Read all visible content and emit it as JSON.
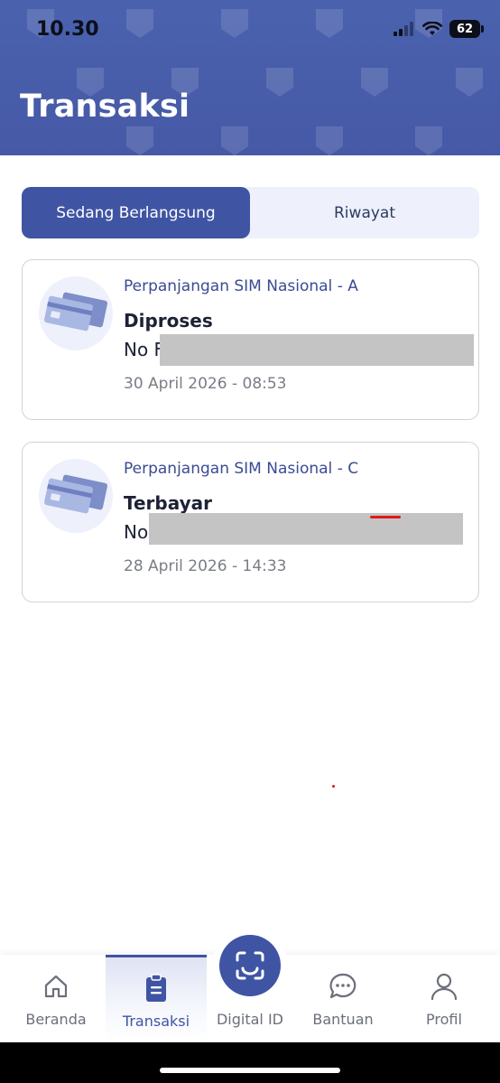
{
  "status_bar": {
    "time": "10.30",
    "battery": "62",
    "signal_icon": "cellular-signal-icon",
    "wifi_icon": "wifi-icon"
  },
  "header": {
    "title": "Transaksi"
  },
  "tabs": [
    {
      "label": "Sedang Berlangsung",
      "active": true
    },
    {
      "label": "Riwayat",
      "active": false
    }
  ],
  "transactions": [
    {
      "service": "Perpanjangan SIM Nasional - A",
      "status": "Diproses",
      "number_prefix": "No F",
      "date": "30 April 2026 - 08:53",
      "icon": "credit-card-icon"
    },
    {
      "service": "Perpanjangan SIM Nasional - C",
      "status": "Terbayar",
      "number_prefix": "No",
      "date": "28 April 2026 - 14:33",
      "icon": "credit-card-icon"
    }
  ],
  "bottom_nav": [
    {
      "label": "Beranda",
      "icon": "home-icon",
      "active": false
    },
    {
      "label": "Transaksi",
      "icon": "clipboard-icon",
      "active": true
    },
    {
      "label": "Digital ID",
      "icon": "scan-icon",
      "active": false
    },
    {
      "label": "Bantuan",
      "icon": "chat-bubble-icon",
      "active": false
    },
    {
      "label": "Profil",
      "icon": "user-icon",
      "active": false
    }
  ],
  "colors": {
    "primary": "#3f54a3",
    "header": "#4a62ae",
    "accent_text": "#3b4b94",
    "redaction": "#c4c4c4"
  }
}
